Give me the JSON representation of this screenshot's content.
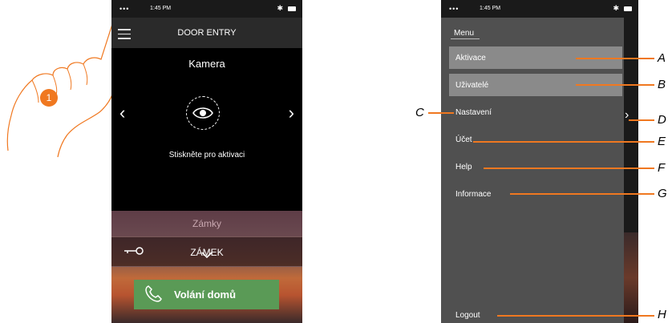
{
  "left_phone": {
    "status": {
      "signal": "•••",
      "time": "1:45 PM"
    },
    "app_title": "DOOR ENTRY",
    "camera_title": "Kamera",
    "camera_caption": "Stiskněte pro aktivaci",
    "prev_arrow": "‹",
    "next_arrow": "›",
    "locks_title": "Zámky",
    "lock_label": "ZÁMEK",
    "call_button": "Volání domů",
    "step_badge": "1"
  },
  "right_phone": {
    "status": {
      "signal": "•••",
      "time": "1:45 PM"
    },
    "menu_title": "Menu",
    "items": [
      {
        "label": "Aktivace",
        "highlighted": true
      },
      {
        "label": "Uživatelé",
        "highlighted": true
      },
      {
        "label": "Nastavení",
        "highlighted": false
      },
      {
        "label": "Účet",
        "highlighted": false
      },
      {
        "label": "Help",
        "highlighted": false
      },
      {
        "label": "Informace",
        "highlighted": false
      }
    ],
    "logout": "Logout",
    "side_arrow": "›"
  },
  "callouts": {
    "A": "A",
    "B": "B",
    "C": "C",
    "D": "D",
    "E": "E",
    "F": "F",
    "G": "G",
    "H": "H"
  },
  "colors": {
    "accent": "#f07820",
    "call_green": "#5a9a56",
    "drawer_bg": "#505050",
    "highlight": "#8a8a8a"
  }
}
